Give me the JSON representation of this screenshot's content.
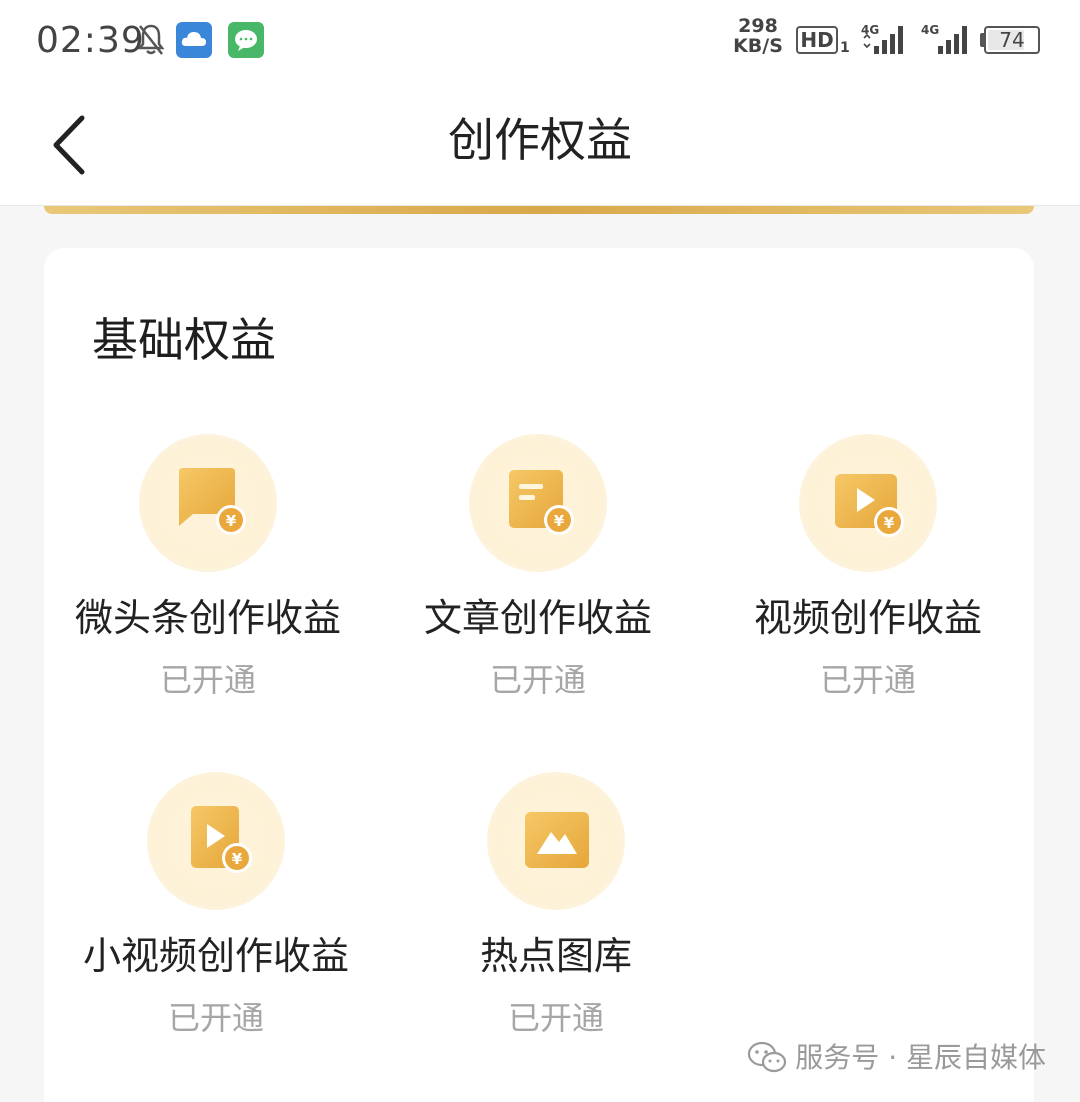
{
  "status_bar": {
    "time": "02:39",
    "net_speed_value": "298",
    "net_speed_unit": "KB/S",
    "hd_label": "HD",
    "hd_sub": "1",
    "signal1_label": "4G",
    "signal2_label": "4G",
    "battery_level": "74",
    "battery_fraction": 0.74
  },
  "nav": {
    "title": "创作权益",
    "back_icon": "chevron-left-icon"
  },
  "section": {
    "title": "基础权益"
  },
  "benefits": [
    {
      "label": "微头条创作收益",
      "status": "已开通",
      "icon": "speech-bubble-yuan-icon"
    },
    {
      "label": "文章创作收益",
      "status": "已开通",
      "icon": "document-yuan-icon"
    },
    {
      "label": "视频创作收益",
      "status": "已开通",
      "icon": "video-yuan-icon"
    },
    {
      "label": "小视频创作收益",
      "status": "已开通",
      "icon": "short-video-yuan-icon"
    },
    {
      "label": "热点图库",
      "status": "已开通",
      "icon": "image-gallery-icon"
    }
  ],
  "watermark": {
    "text": "服务号 · 星辰自媒体"
  },
  "colors": {
    "accent_gold": "#e8b04a",
    "icon_bg": "#fdf1d6",
    "status_gray": "#a6a6a6"
  }
}
